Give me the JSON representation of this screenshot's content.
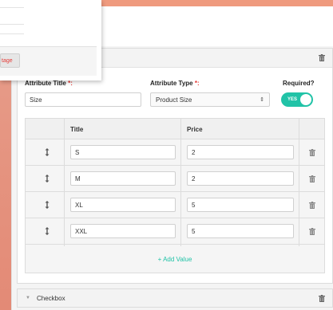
{
  "attribute": {
    "title_label": "Attribute Title",
    "title_required_mark": "*:",
    "title_value": "Size",
    "type_label": "Attribute Type",
    "type_required_mark": "*:",
    "type_value": "Product Size",
    "required_label": "Required?",
    "required_toggle_text": "YES"
  },
  "table": {
    "columns": [
      "Title",
      "Price"
    ],
    "rows": [
      {
        "title": "S",
        "price": "2"
      },
      {
        "title": "M",
        "price": "2"
      },
      {
        "title": "XL",
        "price": "5"
      },
      {
        "title": "XXL",
        "price": "5"
      }
    ],
    "add_value_label": "+ Add Value"
  },
  "checkbox_section": {
    "title": "Checkbox"
  },
  "popup": {
    "button_label": "tage"
  },
  "colors": {
    "accent": "#21c3a7",
    "required": "#e53935",
    "backdrop": "#e5937f"
  }
}
